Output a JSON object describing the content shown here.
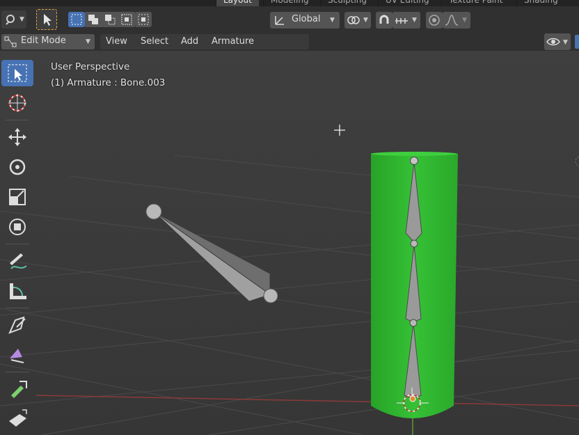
{
  "workspace_tabs": [
    "Layout",
    "Modeling",
    "Sculpting",
    "UV Editing",
    "Texture Paint",
    "Shading"
  ],
  "header": {
    "orientation_label": "Global"
  },
  "menu": {
    "mode": "Edit Mode",
    "items": [
      "View",
      "Select",
      "Add",
      "Armature"
    ]
  },
  "overlay": {
    "view_name": "User Perspective",
    "object_info": "(1) Armature : Bone.003"
  },
  "icons": [
    "editor-type-icon",
    "select-box-icon",
    "cursor-icon",
    "move-icon",
    "rotate-icon",
    "scale-icon",
    "transform-icon",
    "annotate-icon",
    "measure-icon",
    "extrude-icon",
    "roll-icon",
    "bone-size-icon",
    "envelope-icon",
    "visibility-icon",
    "snap-icon",
    "proportional-icon",
    "pivot-icon"
  ],
  "colors": {
    "selected": "#4772b3",
    "cylinder": "#2fb32f",
    "bone": "#8a8a8a"
  }
}
